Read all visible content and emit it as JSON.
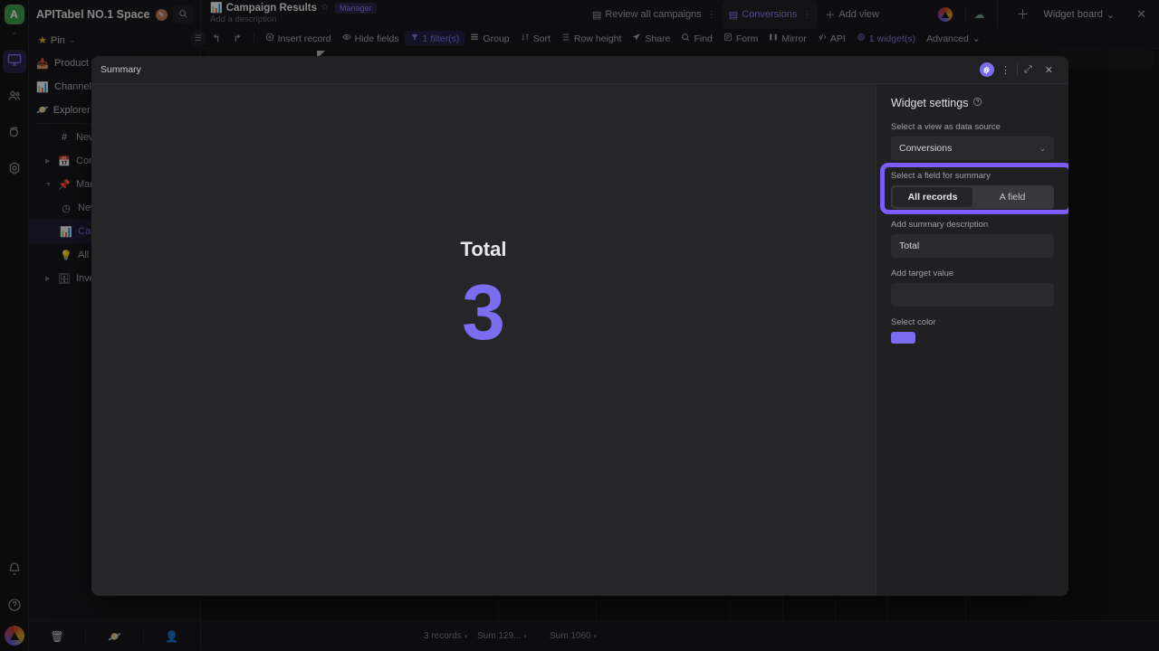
{
  "rail": {
    "logo": "A",
    "items": [
      {
        "name": "monitor-icon",
        "label": "Workspace"
      },
      {
        "name": "people-icon",
        "label": "Members"
      },
      {
        "name": "planet-icon",
        "label": "Space"
      },
      {
        "name": "camera-icon",
        "label": "Automation"
      }
    ],
    "bottom": [
      {
        "name": "bell-icon",
        "label": "Notifications"
      },
      {
        "name": "help-icon",
        "label": "Help"
      }
    ]
  },
  "sidebar": {
    "space_title": "APITabel NO.1 Space",
    "search_icon": "search-icon",
    "pin_label": "Pin",
    "pinned": [
      {
        "icon": "📥",
        "label": "Product"
      },
      {
        "icon": "📊",
        "label": "Channel"
      }
    ],
    "section_label": "Explorer",
    "items": [
      {
        "icon": "#",
        "label": "New",
        "indent": 1,
        "arrow": ""
      },
      {
        "icon": "📅",
        "label": "Content",
        "indent": 1,
        "arrow": "▶"
      },
      {
        "icon": "📌",
        "label": "Marketing",
        "indent": 1,
        "arrow": "▼"
      },
      {
        "icon": "◷",
        "label": "News",
        "indent": 2,
        "arrow": ""
      },
      {
        "icon": "📊",
        "label": "Campaign Results",
        "indent": 2,
        "arrow": "",
        "selected": true
      },
      {
        "icon": "💡",
        "label": "All ideas",
        "indent": 2,
        "arrow": ""
      },
      {
        "icon": "🗄",
        "label": "Inventory",
        "indent": 1,
        "arrow": "▶"
      }
    ],
    "bottom_icons": [
      {
        "name": "trash-icon",
        "glyph": "🗑"
      },
      {
        "name": "planet-icon",
        "glyph": "🪐"
      },
      {
        "name": "add-member-icon",
        "glyph": "👤"
      }
    ]
  },
  "topbar": {
    "datasheet_icon": "📊",
    "datasheet_name": "Campaign Results",
    "star_icon": "☆",
    "role_badge": "Manager",
    "description_placeholder": "Add a description",
    "views": [
      {
        "label": "Review all campaigns",
        "active": false
      },
      {
        "label": "Conversions",
        "active": true
      }
    ],
    "add_view_label": "Add view",
    "widget_board_label": "Widget board",
    "close_icon": "✕",
    "plus_icon": "＋"
  },
  "toolbar": {
    "undo_icon": "↰",
    "redo_icon": "↱",
    "items": [
      {
        "label": "Insert record",
        "icon": "plus-circle-icon",
        "style": "normal"
      },
      {
        "label": "Hide fields",
        "icon": "eye-icon",
        "style": "normal"
      },
      {
        "label": "1 filter(s)",
        "icon": "filter-icon",
        "style": "accent"
      },
      {
        "label": "Group",
        "icon": "group-icon",
        "style": "normal"
      },
      {
        "label": "Sort",
        "icon": "sort-icon",
        "style": "normal"
      },
      {
        "label": "Row height",
        "icon": "row-height-icon",
        "style": "normal"
      },
      {
        "label": "Share",
        "icon": "share-icon",
        "style": "normal"
      },
      {
        "label": "Find",
        "icon": "search-icon",
        "style": "normal"
      },
      {
        "label": "Form",
        "icon": "form-icon",
        "style": "normal"
      },
      {
        "label": "Mirror",
        "icon": "mirror-icon",
        "style": "normal"
      },
      {
        "label": "API",
        "icon": "api-icon",
        "style": "normal"
      },
      {
        "label": "1 widget(s)",
        "icon": "widget-icon",
        "style": "accent2"
      },
      {
        "label": "Advanced",
        "icon": "chevron-down-icon",
        "style": "normal"
      }
    ]
  },
  "status": {
    "records": "3 records",
    "sum1": "Sum 129...",
    "sum2": "Sum 1060"
  },
  "modal": {
    "title": "Summary",
    "header_icons": [
      {
        "name": "widget-gear-icon"
      },
      {
        "name": "more-vertical-icon",
        "glyph": "⋮"
      },
      {
        "name": "expand-icon",
        "glyph": "⤢"
      },
      {
        "name": "close-icon",
        "glyph": "✕"
      }
    ],
    "widget": {
      "label": "Total",
      "value": "3"
    },
    "settings": {
      "title": "Widget settings",
      "help_icon": "?",
      "data_source_label": "Select a view as data source",
      "data_source_value": "Conversions",
      "field_label": "Select a field for summary",
      "segments": [
        {
          "label": "All records",
          "active": true
        },
        {
          "label": "A field",
          "active": false
        }
      ],
      "description_label": "Add summary description",
      "description_value": "Total",
      "target_label": "Add target value",
      "target_value": "",
      "color_label": "Select color",
      "color_value": "#7c6cf0"
    }
  },
  "colors": {
    "accent": "#7c6cf0",
    "highlight": "#7c5cfa",
    "bg": "#19191c"
  }
}
